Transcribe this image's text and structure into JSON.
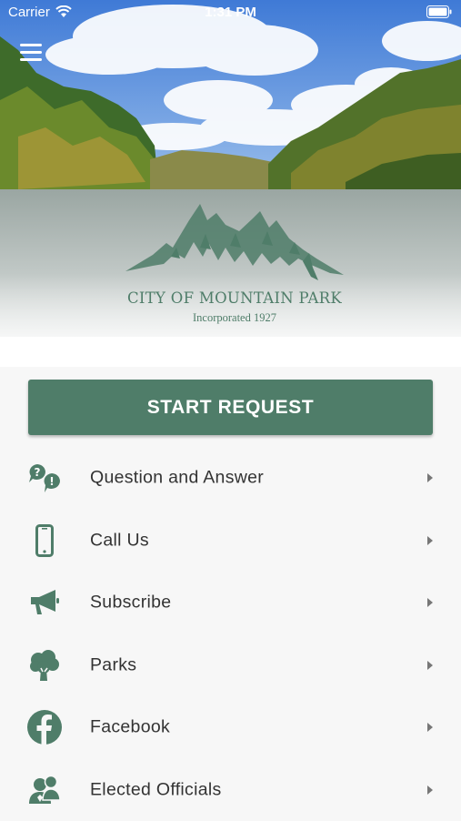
{
  "status_bar": {
    "carrier": "Carrier",
    "time": "1:31 PM"
  },
  "hero": {
    "logo_title": "CITY OF MOUNTAIN PARK",
    "logo_subtitle": "Incorporated 1927"
  },
  "actions": {
    "start_request_label": "START REQUEST"
  },
  "menu": {
    "items": [
      {
        "label": "Question and Answer",
        "icon": "question-answer-icon"
      },
      {
        "label": "Call Us",
        "icon": "phone-icon"
      },
      {
        "label": "Subscribe",
        "icon": "megaphone-icon"
      },
      {
        "label": "Parks",
        "icon": "tree-icon"
      },
      {
        "label": "Facebook",
        "icon": "facebook-icon"
      },
      {
        "label": "Elected Officials",
        "icon": "people-icon"
      }
    ]
  },
  "colors": {
    "brand": "#4f7d69",
    "background": "#f7f7f7",
    "text": "#333333"
  }
}
